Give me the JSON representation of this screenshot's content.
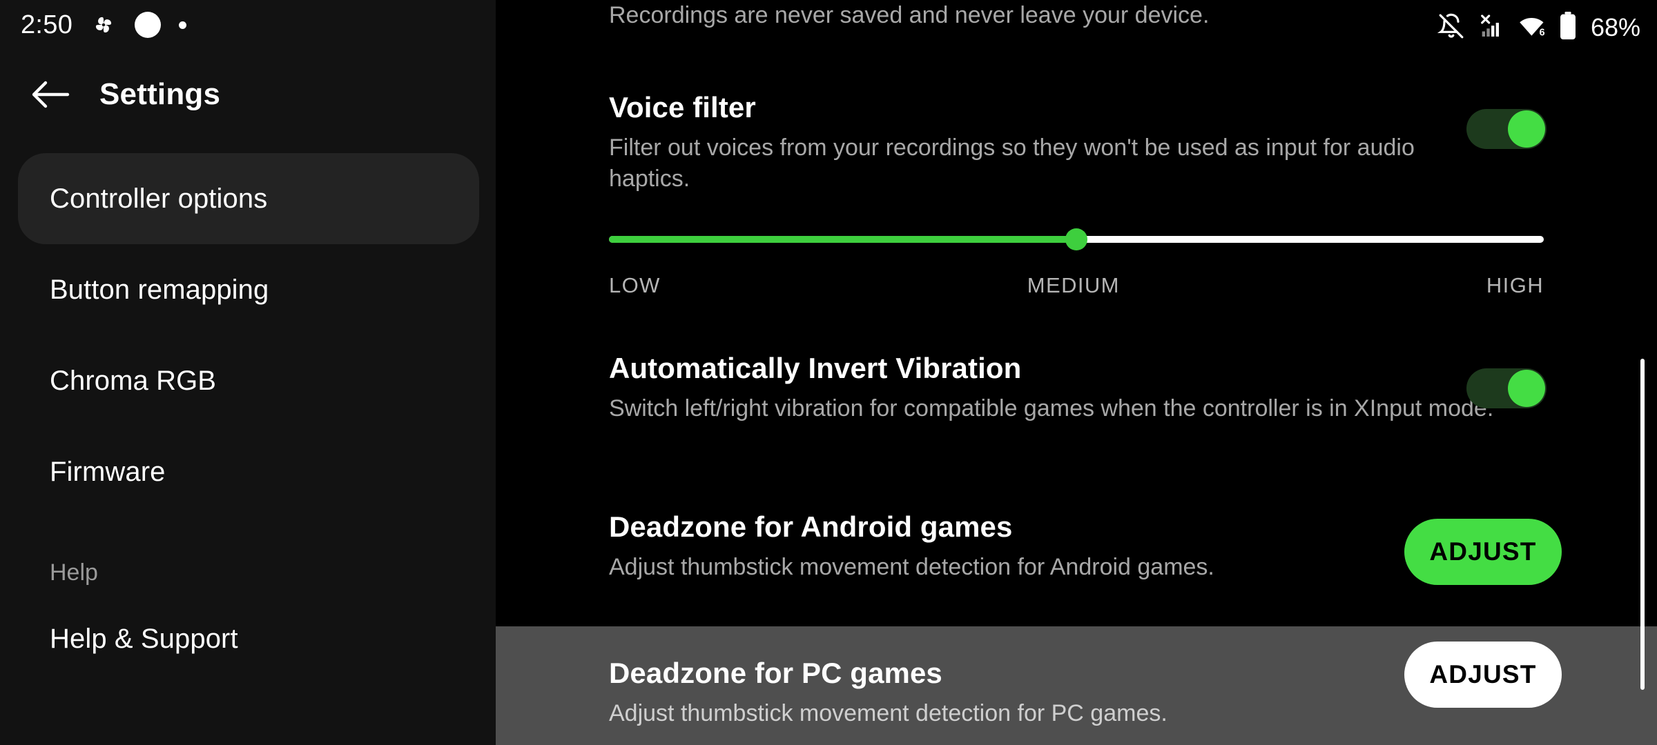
{
  "status_bar": {
    "time": "2:50",
    "left_icons": [
      "pinwheel-icon",
      "white-circle-icon",
      "small-dot-icon"
    ],
    "right_icons": [
      "notifications-off-icon",
      "cellular-no-sim-icon",
      "wifi-6-icon",
      "battery-icon"
    ],
    "battery_percent": "68%"
  },
  "sidebar": {
    "title": "Settings",
    "back_icon": "back-arrow-icon",
    "items": [
      {
        "label": "Controller options",
        "selected": true,
        "type": "item"
      },
      {
        "label": "Button remapping",
        "selected": false,
        "type": "item"
      },
      {
        "label": "Chroma RGB",
        "selected": false,
        "type": "item"
      },
      {
        "label": "Firmware",
        "selected": false,
        "type": "item"
      },
      {
        "label": "Help",
        "selected": false,
        "type": "section"
      },
      {
        "label": "Help & Support",
        "selected": false,
        "type": "item"
      }
    ]
  },
  "main": {
    "clipped_description": "Recordings are never saved and never leave your device.",
    "settings": [
      {
        "title": "Voice filter",
        "description": "Filter out voices from your recordings so they won't be used as input for audio haptics.",
        "control": "toggle",
        "toggle_on": true
      },
      {
        "control": "slider",
        "value_percent": 50,
        "labels": {
          "low": "LOW",
          "medium": "MEDIUM",
          "high": "HIGH"
        }
      },
      {
        "title": "Automatically Invert Vibration",
        "description": "Switch left/right vibration for compatible games when the controller is in XInput mode.",
        "control": "toggle",
        "toggle_on": true
      },
      {
        "title": "Deadzone for Android games",
        "description": "Adjust thumbstick movement detection for Android games.",
        "control": "button",
        "button_label": "ADJUST",
        "button_style": "green"
      },
      {
        "title": "Deadzone for PC games",
        "description": "Adjust thumbstick movement detection for PC games.",
        "control": "button",
        "button_label": "ADJUST",
        "button_style": "white",
        "highlighted": true
      }
    ]
  },
  "colors": {
    "accent_green": "#44dd44",
    "slider_green": "#3ecf3e",
    "sidebar_bg": "#121212",
    "main_bg": "#000000",
    "selected_item_bg": "#232323",
    "highlight_row_bg": "#4f4f4f",
    "muted_text": "#a8a8a8"
  }
}
